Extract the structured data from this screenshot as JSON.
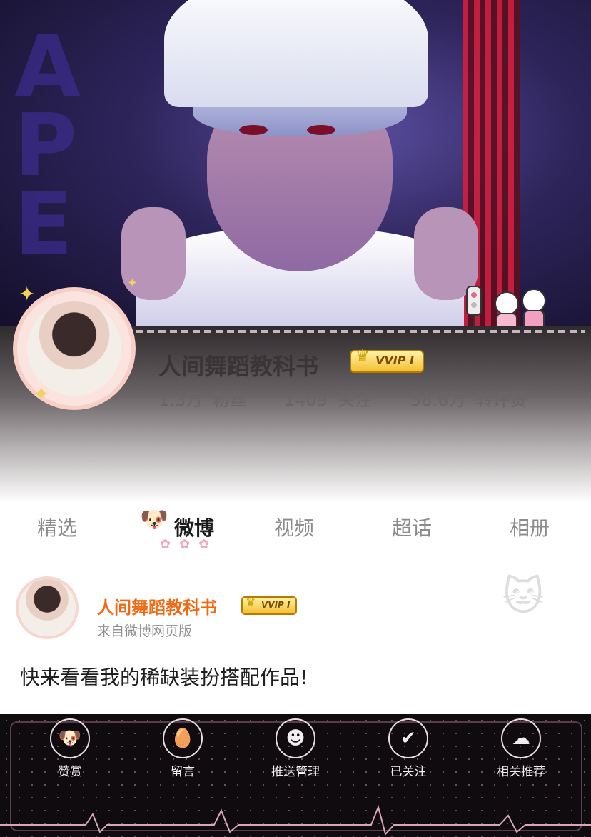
{
  "profile": {
    "username": "人间舞蹈教科书",
    "vip_label": "VVIP I",
    "stats": [
      {
        "value": "1.3万",
        "label": "粉丝"
      },
      {
        "value": "1409",
        "label": "关注"
      },
      {
        "value": "58.6万",
        "label": "转评赞"
      }
    ]
  },
  "tabs": [
    {
      "label": "精选"
    },
    {
      "label": "微博"
    },
    {
      "label": "视频"
    },
    {
      "label": "超话"
    },
    {
      "label": "相册"
    }
  ],
  "post": {
    "author": "人间舞蹈教科书",
    "vip_label": "VVIP I",
    "source": "来自微博网页版",
    "text": "快来看看我的稀缺装扮搭配作品!"
  },
  "actions": [
    {
      "label": "赞赏",
      "icon": "dog-reward-icon"
    },
    {
      "label": "留言",
      "icon": "egg-message-icon"
    },
    {
      "label": "推送管理",
      "icon": "character-push-icon"
    },
    {
      "label": "已关注",
      "icon": "character-followed-icon"
    },
    {
      "label": "相关推荐",
      "icon": "cloud-recommend-icon"
    }
  ],
  "colors": {
    "username_orange": "#f06a15",
    "tab_active": "#1b1b1b",
    "tab_inactive": "#8b8b8b"
  }
}
